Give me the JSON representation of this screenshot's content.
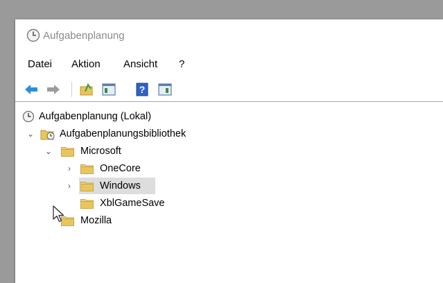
{
  "window": {
    "title": "Aufgabenplanung"
  },
  "menu": {
    "items": [
      "Datei",
      "Aktion",
      "Ansicht",
      "?"
    ]
  },
  "toolbar": {
    "buttons": [
      "back-arrow-icon",
      "forward-arrow-icon",
      "folder-up-icon",
      "show-hide-console-tree-icon",
      "help-icon",
      "show-hide-action-pane-icon"
    ]
  },
  "tree": {
    "root": "Aufgabenplanung (Lokal)",
    "library": "Aufgabenplanungsbibliothek",
    "microsoft": "Microsoft",
    "onecore": "OneCore",
    "windows": "Windows",
    "xblgamesave": "XblGameSave",
    "mozilla": "Mozilla"
  },
  "colors": {
    "folder": "#e9c65c",
    "selection": "#dddddd",
    "arrow_blue": "#2c8fd6"
  }
}
